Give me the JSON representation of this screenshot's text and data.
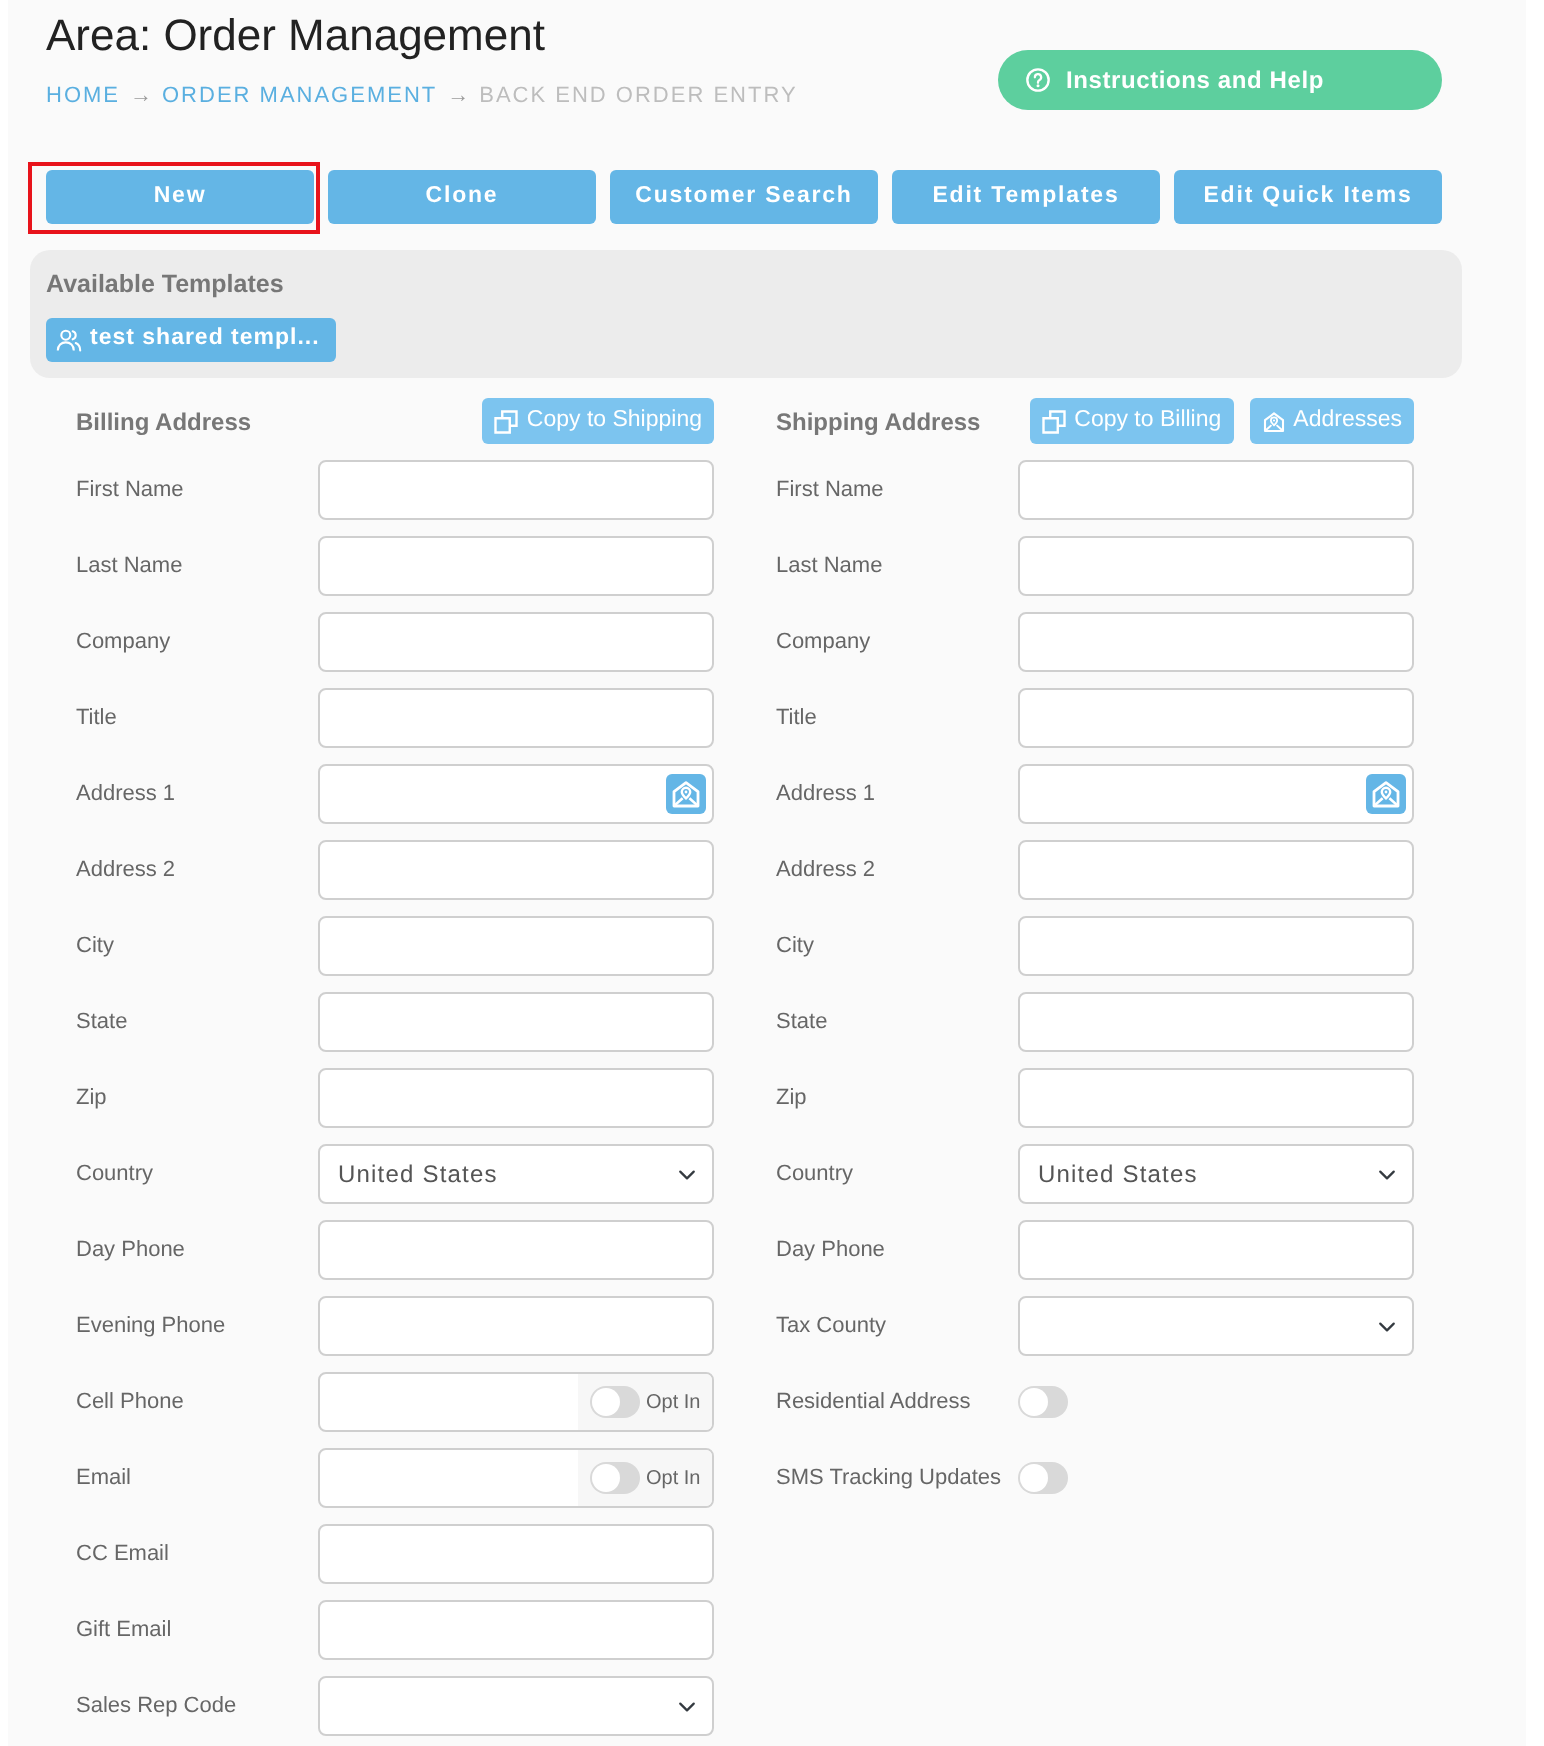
{
  "page": {
    "title": "Area: Order Management"
  },
  "breadcrumb": [
    {
      "label": "HOME",
      "current": false,
      "separator": "→"
    },
    {
      "label": "ORDER MANAGEMENT",
      "current": false,
      "separator": "→"
    },
    {
      "label": "BACK END ORDER ENTRY",
      "current": true
    }
  ],
  "help_button": {
    "label": "Instructions and Help"
  },
  "actions": [
    {
      "label": "New",
      "highlighted": true
    },
    {
      "label": "Clone",
      "highlighted": false
    },
    {
      "label": "Customer Search",
      "highlighted": false
    },
    {
      "label": "Edit Templates",
      "highlighted": false
    },
    {
      "label": "Edit Quick Items",
      "highlighted": false
    }
  ],
  "templates": {
    "title": "Available Templates",
    "items": [
      {
        "label": "test shared templ..."
      }
    ]
  },
  "billing": {
    "title": "Billing Address",
    "buttons": [
      {
        "kind": "copy",
        "label": "Copy to Shipping"
      }
    ],
    "fields": [
      {
        "kind": "text",
        "label": "First Name"
      },
      {
        "kind": "text",
        "label": "Last Name"
      },
      {
        "kind": "text",
        "label": "Company"
      },
      {
        "kind": "text",
        "label": "Title"
      },
      {
        "kind": "address",
        "label": "Address 1"
      },
      {
        "kind": "text",
        "label": "Address 2"
      },
      {
        "kind": "text",
        "label": "City"
      },
      {
        "kind": "text",
        "label": "State"
      },
      {
        "kind": "text",
        "label": "Zip"
      },
      {
        "kind": "select",
        "label": "Country",
        "value": "United States"
      },
      {
        "kind": "text",
        "label": "Day Phone"
      },
      {
        "kind": "text",
        "label": "Evening Phone"
      },
      {
        "kind": "optin",
        "label": "Cell Phone",
        "toggle_label": "Opt In",
        "on": false
      },
      {
        "kind": "optin",
        "label": "Email",
        "toggle_label": "Opt In",
        "on": false
      },
      {
        "kind": "text",
        "label": "CC Email"
      },
      {
        "kind": "text",
        "label": "Gift Email"
      },
      {
        "kind": "select",
        "label": "Sales Rep Code"
      }
    ]
  },
  "shipping": {
    "title": "Shipping Address",
    "buttons": [
      {
        "kind": "copy",
        "label": "Copy to Billing"
      },
      {
        "kind": "addresses",
        "label": "Addresses"
      }
    ],
    "fields": [
      {
        "kind": "text",
        "label": "First Name"
      },
      {
        "kind": "text",
        "label": "Last Name"
      },
      {
        "kind": "text",
        "label": "Company"
      },
      {
        "kind": "text",
        "label": "Title"
      },
      {
        "kind": "address",
        "label": "Address 1"
      },
      {
        "kind": "text",
        "label": "Address 2"
      },
      {
        "kind": "text",
        "label": "City"
      },
      {
        "kind": "text",
        "label": "State"
      },
      {
        "kind": "text",
        "label": "Zip"
      },
      {
        "kind": "select",
        "label": "Country",
        "value": "United States"
      },
      {
        "kind": "text",
        "label": "Day Phone"
      },
      {
        "kind": "select",
        "label": "Tax County"
      },
      {
        "kind": "toggle",
        "label": "Residential Address",
        "on": false
      },
      {
        "kind": "toggle",
        "label": "SMS Tracking Updates",
        "on": false
      }
    ]
  }
}
